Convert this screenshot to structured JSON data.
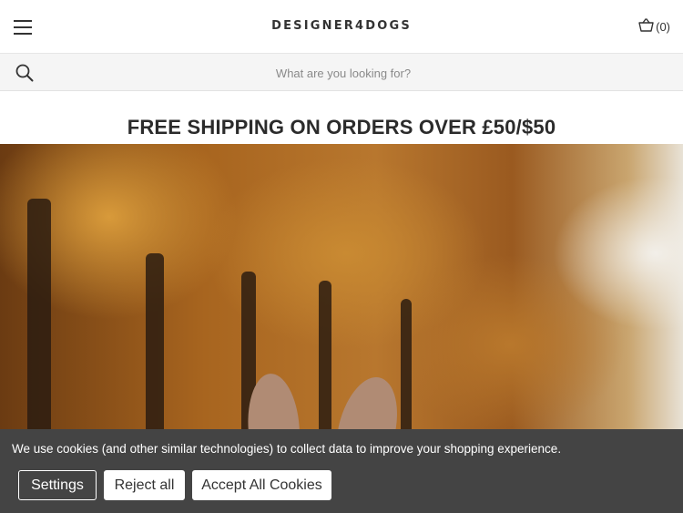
{
  "header": {
    "logo": "DESIGNER4DOGS",
    "cart_count": "(0)"
  },
  "search": {
    "placeholder": "What are you looking for?"
  },
  "promo": {
    "text": "FREE SHIPPING ON ORDERS OVER £50/$50"
  },
  "hero": {
    "image": "autumn-trees-dog-ears"
  },
  "cookie_banner": {
    "message": "We use cookies (and other similar technologies) to collect data to improve your shopping experience.",
    "settings_label": "Settings",
    "reject_label": "Reject all",
    "accept_label": "Accept All Cookies"
  },
  "icons": {
    "menu": "hamburger-icon",
    "cart": "basket-icon",
    "search": "search-icon"
  }
}
